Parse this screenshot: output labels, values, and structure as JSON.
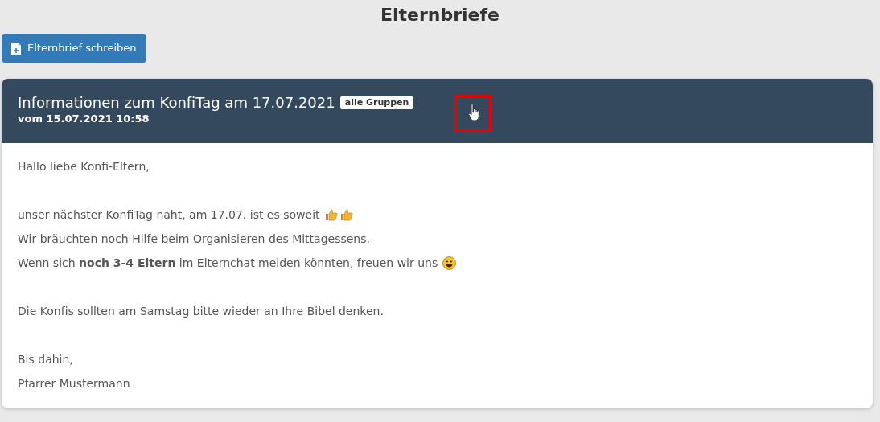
{
  "page_title": "Elternbriefe",
  "write_button": {
    "label": "Elternbrief schreiben"
  },
  "letter": {
    "title": "Informationen zum KonfiTag am 17.07.2021",
    "group_badge": "alle Gruppen",
    "date": "vom 15.07.2021 10:58",
    "pointer_highlight": true,
    "blocks": [
      [
        {
          "text": "Hallo liebe Konfi-Eltern,"
        }
      ],
      [
        {
          "text": "unser nächster KonfiTag naht, am 17.07. ist es soweit",
          "kind": "thumbs"
        },
        {
          "text": "Wir bräuchten noch Hilfe beim Organisieren des Mittagessens."
        },
        {
          "text": "Wenn sich **noch 3-4 Eltern** im Elternchat melden könnten, freuen wir uns",
          "kind": "smiley"
        }
      ],
      [
        {
          "text": "Die Konfis sollten am Samstag bitte wieder an Ihre Bibel denken."
        }
      ],
      [
        {
          "text": "Bis dahin,"
        },
        {
          "text": "Pfarrer Mustermann"
        }
      ]
    ]
  }
}
